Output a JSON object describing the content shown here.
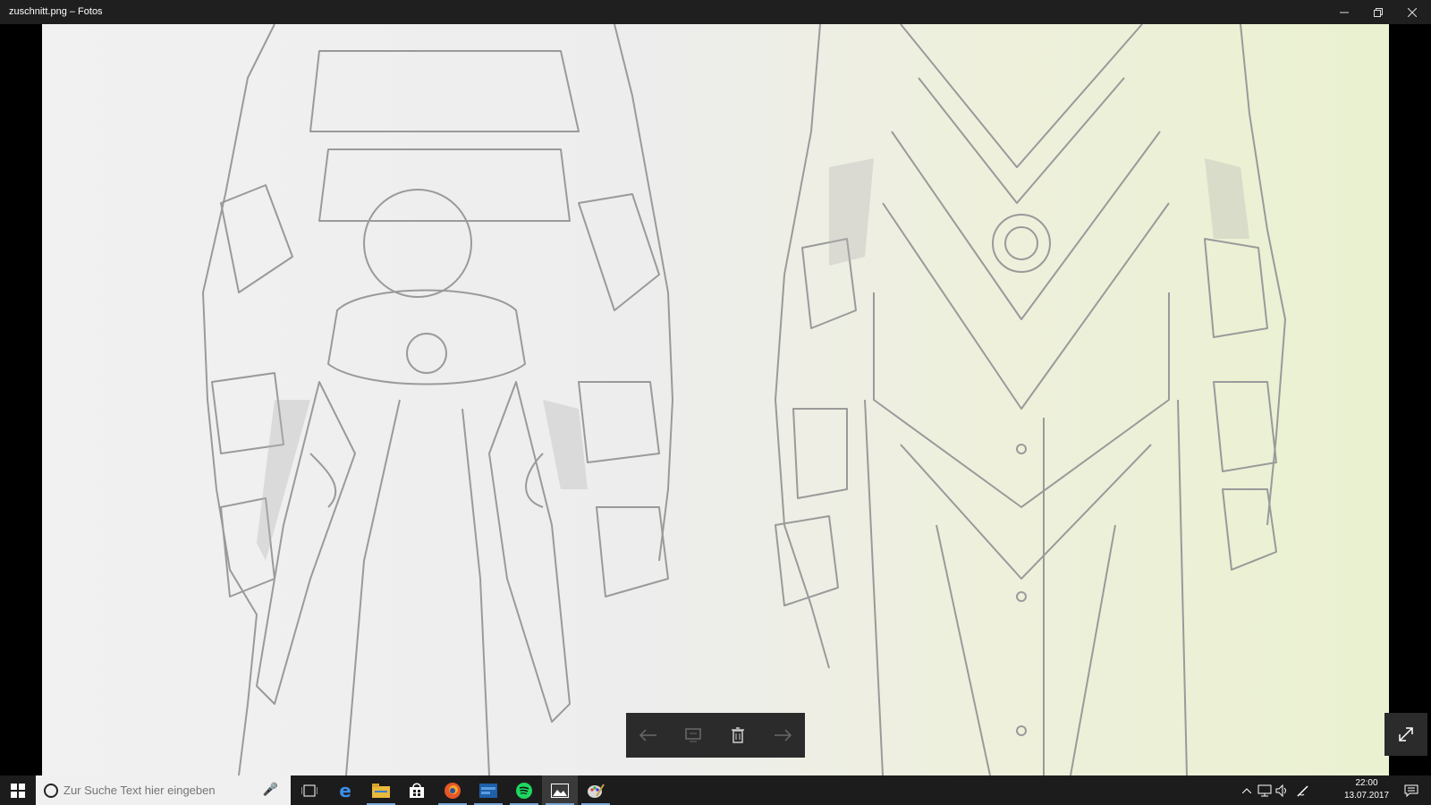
{
  "window": {
    "title": "zuschnitt.png – Fotos",
    "minimize_icon": "minimize-icon",
    "maximize_icon": "restore-icon",
    "close_icon": "close-icon"
  },
  "photo_toolbar": {
    "previous_icon": "arrow-left-icon",
    "slideshow_icon": "slideshow-icon",
    "delete_icon": "trash-icon",
    "next_icon": "arrow-right-icon"
  },
  "expand_icon": "expand-icon",
  "taskbar": {
    "search_placeholder": "Zur Suche Text hier eingeben",
    "apps": [
      "start-icon",
      "task-view-icon",
      "edge-icon",
      "file-explorer-icon",
      "store-icon",
      "firefox-icon",
      "app-icon",
      "spotify-icon",
      "photos-icon",
      "paint-icon"
    ],
    "clock_time": "22:00",
    "clock_date": "13.07.2017"
  },
  "colors": {
    "titlebar": "#1f1f1f",
    "taskbar": "#1c1c1c",
    "accent": "#7aa8d8"
  }
}
